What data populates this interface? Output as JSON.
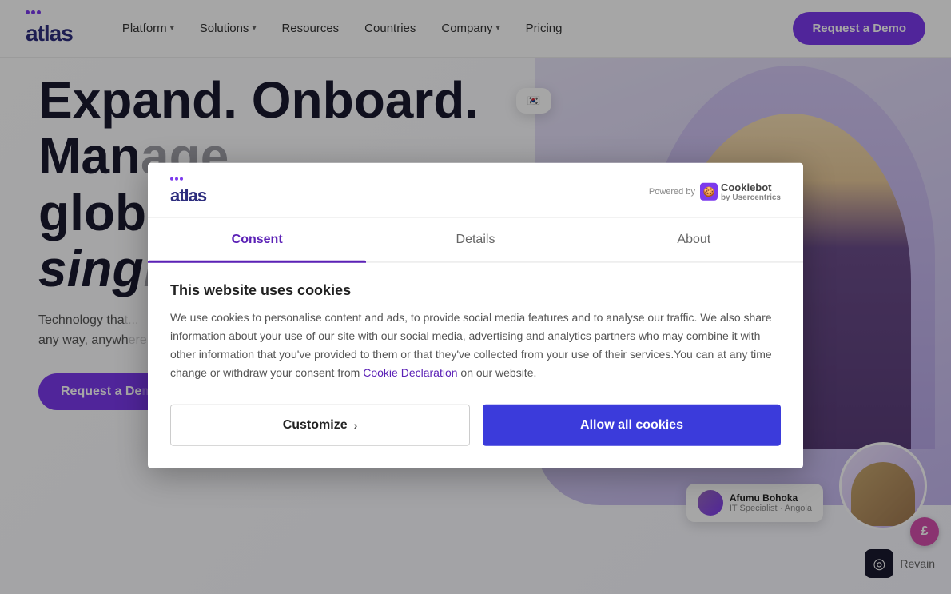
{
  "header": {
    "logo": "atlas",
    "nav": [
      {
        "label": "Platform",
        "hasDropdown": true
      },
      {
        "label": "Solutions",
        "hasDropdown": true
      },
      {
        "label": "Resources",
        "hasDropdown": false
      },
      {
        "label": "Countries",
        "hasDropdown": false
      },
      {
        "label": "Company",
        "hasDropdown": true
      },
      {
        "label": "Pricing",
        "hasDropdown": false
      }
    ],
    "cta_label": "Request a Demo"
  },
  "hero": {
    "line1": "Expand. Onboard.",
    "line2": "Man",
    "line3": "glob",
    "line4": "sing",
    "subtitle": "Technology that...",
    "subtitle_2": "any way, anywh...",
    "cta_label": "Request a De..."
  },
  "cookie_modal": {
    "logo": "atlas",
    "powered_by": "Powered by",
    "cookiebot_name": "Cookiebot",
    "cookiebot_sub": "by Usercentrics",
    "tabs": [
      {
        "label": "Consent",
        "active": true
      },
      {
        "label": "Details",
        "active": false
      },
      {
        "label": "About",
        "active": false
      }
    ],
    "title": "This website uses cookies",
    "body_text": "We use cookies to personalise content and ads, to provide social media features and to analyse our traffic. We also share information about your use of our site with our social media, advertising and analytics partners who may combine it with other information that you've provided to them or that they've collected from your use of their services.You can at any time change or withdraw your consent from",
    "cookie_link_text": "Cookie Declaration",
    "body_text_end": "on our website.",
    "btn_customize": "Customize",
    "btn_allow": "Allow all cookies"
  },
  "flag_card": {
    "flag": "🇰🇷"
  },
  "person_card": {
    "name": "Afumu Bohoka",
    "role": "IT Specialist · Angola"
  },
  "revain": {
    "label": "Revain"
  },
  "pound_badge": "£",
  "colors": {
    "purple": "#7c3aed",
    "dark_purple": "#5b21b6",
    "btn_blue": "#3b3bdb",
    "logo_dark": "#2d2d7e"
  }
}
